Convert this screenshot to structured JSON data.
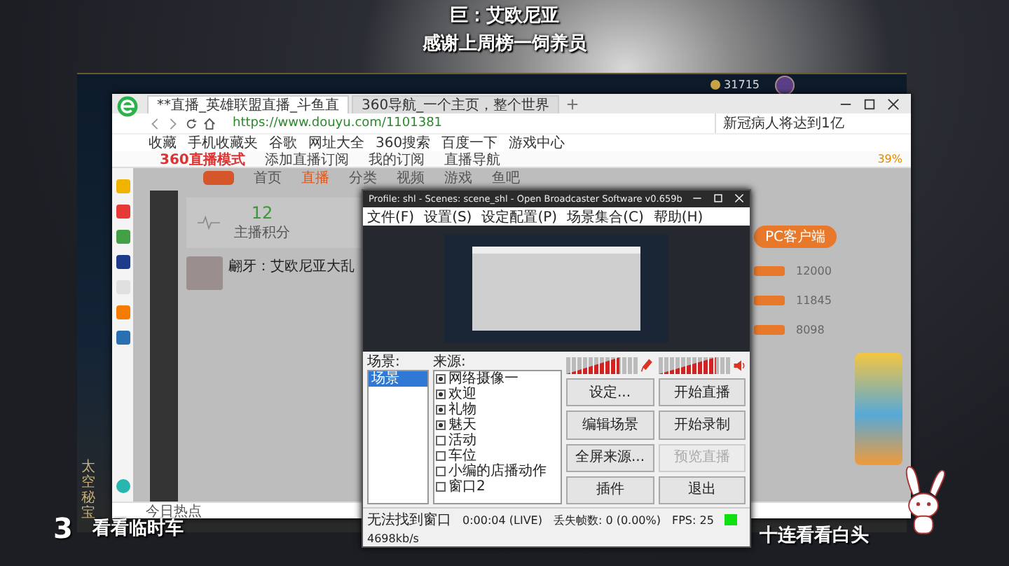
{
  "overlay": {
    "top_lines": [
      "巨：艾欧尼亚",
      "感谢上周榜一饲养员"
    ],
    "bottom_number": "3",
    "bottom_left_text": "看看临时车",
    "bottom_right_text": "十连看看白头"
  },
  "game_client": {
    "currency": "31715",
    "side_banner": "太空秘宝"
  },
  "browser": {
    "tabs": [
      {
        "title": "**直播_英雄联盟直播_斗鱼直",
        "selected": true
      },
      {
        "title": "360导航_一个主页，整个世界",
        "selected": false
      }
    ],
    "url": "https://www.douyu.com/1101381",
    "search": {
      "value": "新冠病人将达到1亿"
    },
    "bookmarks": [
      "收藏",
      "手机收藏夹",
      "谷歌",
      "网址大全",
      "360搜索",
      "百度一下",
      "游戏中心"
    ],
    "live_bar": {
      "items": [
        "360直播模式",
        "添加直播订阅",
        "我的订阅",
        "直播导航"
      ],
      "percent": "39%"
    },
    "ticker": "今日热点"
  },
  "page": {
    "nav": [
      {
        "label": "首页",
        "selected": false
      },
      {
        "label": "直播",
        "selected": true
      },
      {
        "label": "分类",
        "selected": false
      },
      {
        "label": "视频",
        "selected": false
      },
      {
        "label": "游戏",
        "selected": false
      },
      {
        "label": "鱼吧",
        "selected": false
      }
    ],
    "stat": {
      "value": "12",
      "label": "主播积分"
    },
    "streamer_title": "翩牙：艾欧尼亚大乱",
    "client_button": "PC客户端",
    "ranks": [
      {
        "score": "12000"
      },
      {
        "score": "11845"
      },
      {
        "score": "8098"
      }
    ]
  },
  "obs": {
    "title": "Profile: shl - Scenes: scene_shl - Open Broadcaster Software v0.659b",
    "menu": [
      "文件(F)",
      "设置(S)",
      "设定配置(P)",
      "场景集合(C)",
      "帮助(H)"
    ],
    "scenes_label": "场景:",
    "scenes": [
      {
        "name": "场景",
        "selected": true
      }
    ],
    "sources_label": "来源:",
    "sources": [
      {
        "name": "网络摄像一",
        "checked": true
      },
      {
        "name": "欢迎",
        "checked": true
      },
      {
        "name": "礼物",
        "checked": true
      },
      {
        "name": "魅天",
        "checked": true
      },
      {
        "name": "活动",
        "checked": false
      },
      {
        "name": "车位",
        "checked": false
      },
      {
        "name": "小编的店播动作",
        "checked": false
      },
      {
        "name": "窗口2",
        "checked": false
      }
    ],
    "meters": [
      {
        "kind": "mic",
        "level": 0.75
      },
      {
        "kind": "speaker",
        "level": 0.8
      }
    ],
    "buttons": [
      {
        "label": "设定...",
        "disabled": false
      },
      {
        "label": "开始直播",
        "disabled": false
      },
      {
        "label": "编辑场景",
        "disabled": false
      },
      {
        "label": "开始录制",
        "disabled": false
      },
      {
        "label": "全屏来源...",
        "disabled": false
      },
      {
        "label": "预览直播",
        "disabled": true
      },
      {
        "label": "插件",
        "disabled": false
      },
      {
        "label": "退出",
        "disabled": false
      }
    ],
    "status": {
      "message": "无法找到窗口",
      "time": "0:00:04 (LIVE)",
      "dropped": "丢失帧数: 0 (0.00%)",
      "fps": "FPS: 25",
      "bitrate": "4698kb/s"
    }
  }
}
